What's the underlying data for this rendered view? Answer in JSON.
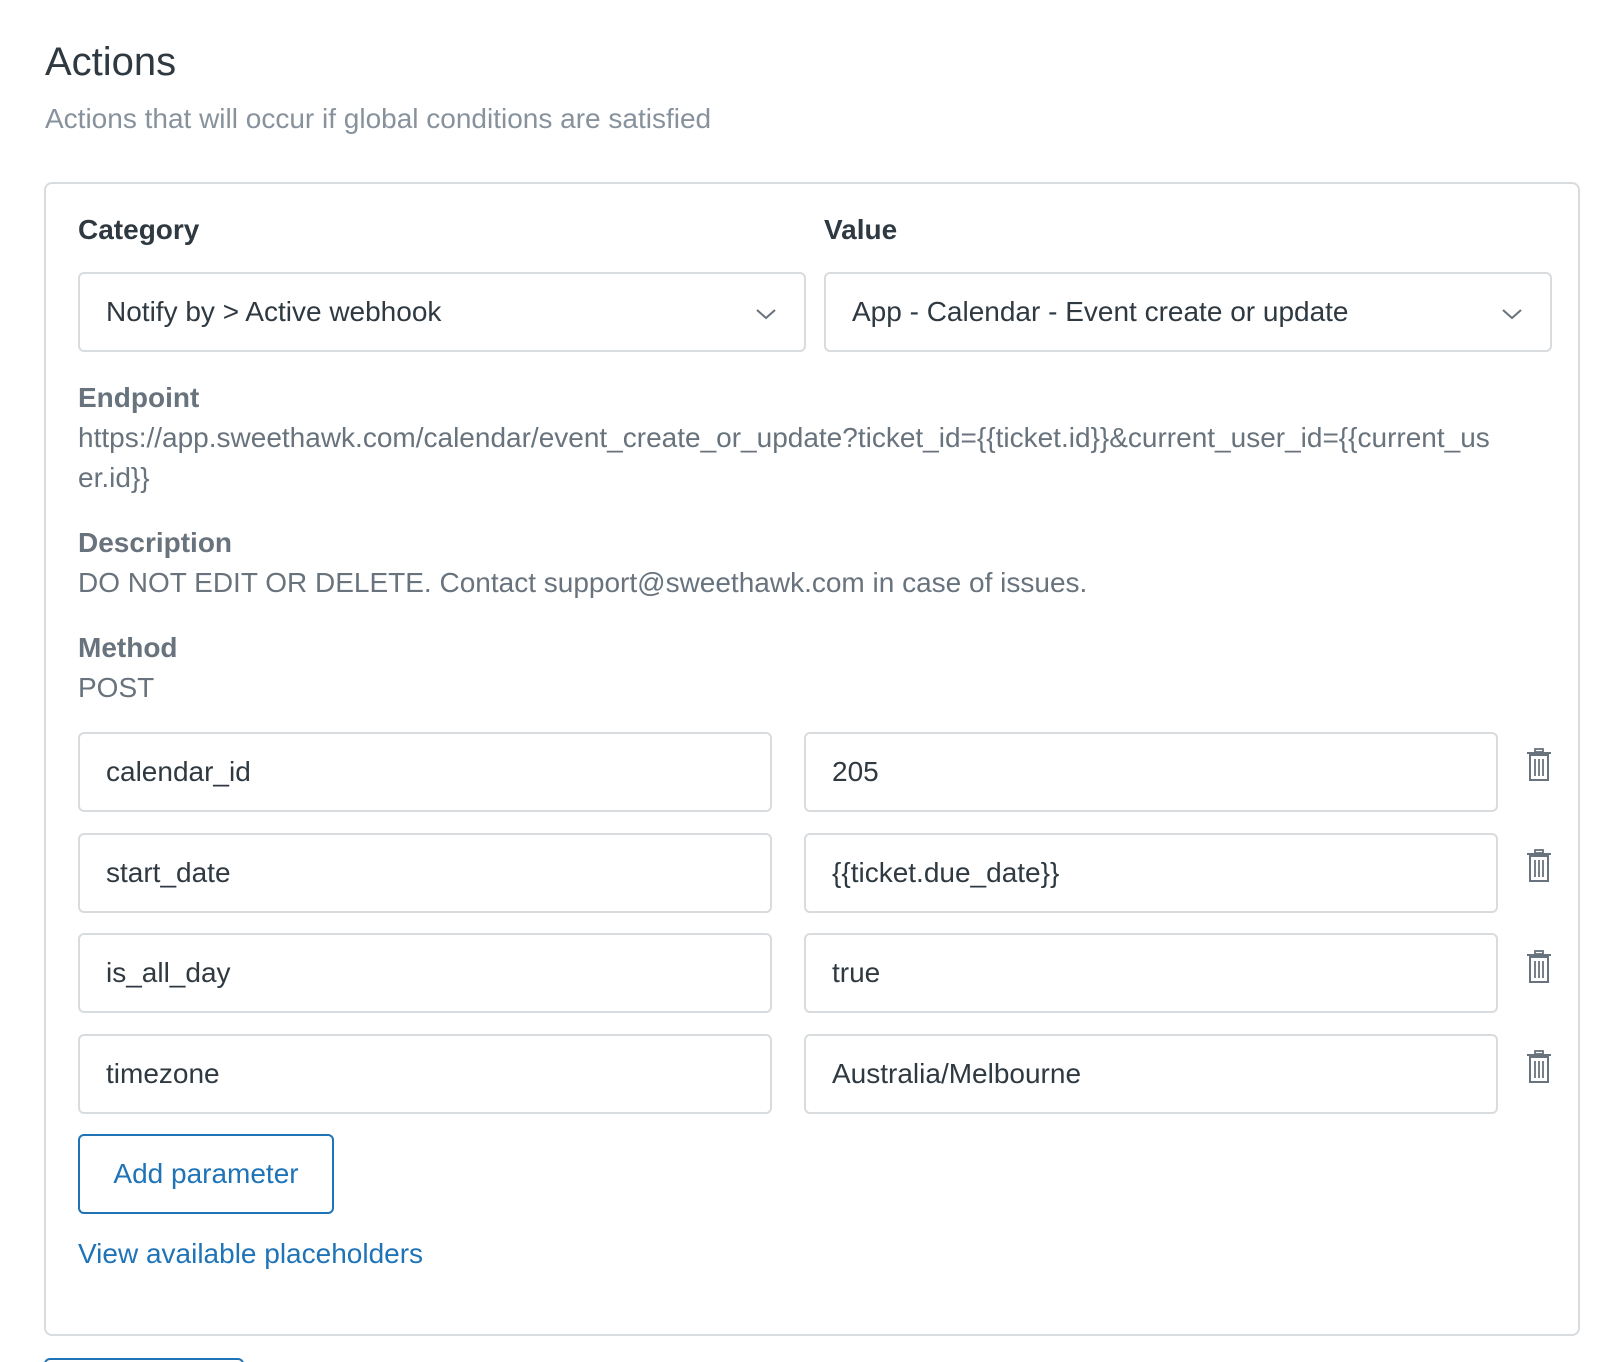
{
  "section": {
    "title": "Actions",
    "subtitle": "Actions that will occur if global conditions are satisfied"
  },
  "category": {
    "label": "Category",
    "selected": "Notify by > Active webhook",
    "icon": "chevron-down-icon"
  },
  "value": {
    "label": "Value",
    "selected": "App - Calendar - Event create or update",
    "icon": "chevron-down-icon"
  },
  "endpoint": {
    "label": "Endpoint",
    "value": "https://app.sweethawk.com/calendar/event_create_or_update?ticket_id={{ticket.id}}&current_user_id={{current_user.id}}"
  },
  "description": {
    "label": "Description",
    "value": "DO NOT EDIT OR DELETE. Contact support@sweethawk.com in case of issues."
  },
  "method": {
    "label": "Method",
    "value": "POST"
  },
  "parameters": [
    {
      "key": "calendar_id",
      "value": "205"
    },
    {
      "key": "start_date",
      "value": "{{ticket.due_date}}"
    },
    {
      "key": "is_all_day",
      "value": "true"
    },
    {
      "key": "timezone",
      "value": "Australia/Melbourne"
    }
  ],
  "actions": {
    "add_parameter": "Add parameter",
    "view_placeholders": "View available placeholders"
  },
  "colors": {
    "accent": "#1f73b7",
    "border": "#d8dcde",
    "muted_text": "#68737d",
    "subtitle_text": "#87929d",
    "primary_text": "#2f3941"
  }
}
